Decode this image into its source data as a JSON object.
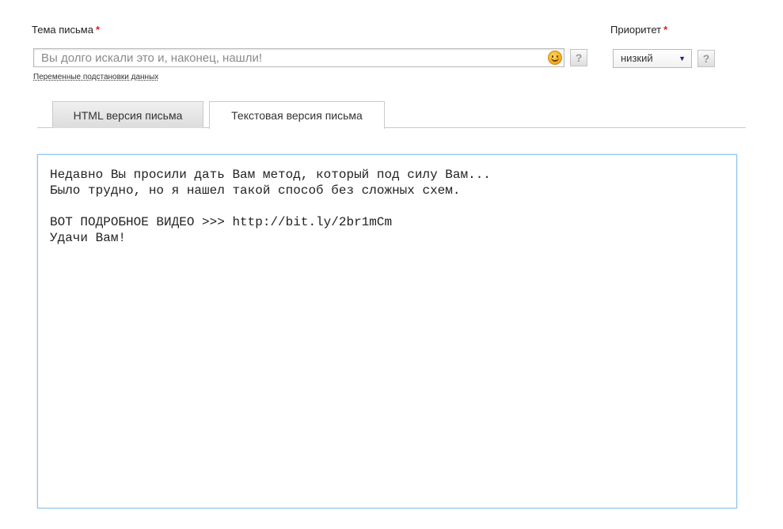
{
  "subject": {
    "label": "Тема письма",
    "required_mark": "*",
    "value": "Вы долго искали это и, наконец, нашли!",
    "help": "?",
    "vars_link": "Переменные подстановки данных"
  },
  "priority": {
    "label": "Приоритет",
    "required_mark": "*",
    "selected": "низкий",
    "arrow": "▼",
    "help": "?"
  },
  "tabs": [
    {
      "label": "HTML версия письма",
      "active": false
    },
    {
      "label": "Текстовая версия письма",
      "active": true
    }
  ],
  "editor": {
    "text": "Недавно Вы просили дать Вам метод, который под силу Вам...\nБыло трудно, но я нашел такой способ без сложных схем.\n\nВОТ ПОДРОБНОЕ ВИДЕО >>> http://bit.ly/2br1mCm\nУдачи Вам!"
  },
  "colors": {
    "required": "#e02020",
    "editor_border": "#8ec4ee",
    "select_arrow": "#1d2a7a"
  },
  "icons": {
    "smiley": "smiley-icon",
    "help": "question-icon"
  }
}
